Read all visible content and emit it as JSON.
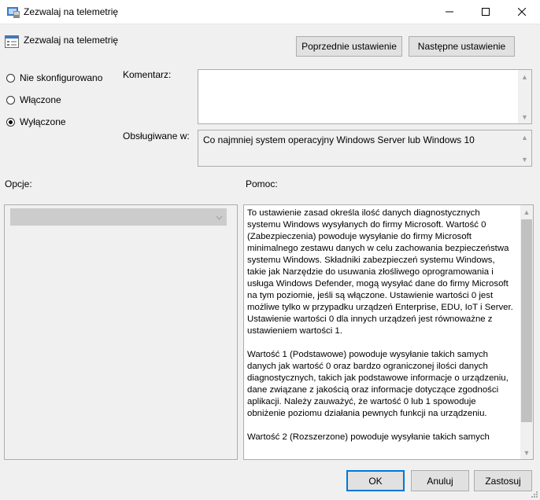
{
  "window": {
    "title": "Zezwalaj na telemetrię",
    "icons": [
      "policy-icon",
      "minimize-icon",
      "maximize-icon",
      "close-icon"
    ]
  },
  "header": {
    "title": "Zezwalaj na telemetrię",
    "prev_button": "Poprzednie ustawienie",
    "next_button": "Następne ustawienie"
  },
  "radios": [
    {
      "label": "Nie skonfigurowano",
      "checked": false
    },
    {
      "label": "Włączone",
      "checked": false
    },
    {
      "label": "Wyłączone",
      "checked": true
    }
  ],
  "comment": {
    "label": "Komentarz:",
    "value": ""
  },
  "supported": {
    "label": "Obsługiwane w:",
    "value": "Co najmniej system operacyjny Windows Server lub Windows 10"
  },
  "options": {
    "label": "Opcje:",
    "dropdown_value": ""
  },
  "help": {
    "label": "Pomoc:",
    "paragraphs": [
      "To ustawienie zasad określa ilość danych diagnostycznych systemu Windows wysyłanych do firmy Microsoft. Wartość 0 (Zabezpieczenia) powoduje wysyłanie do firmy Microsoft minimalnego zestawu danych w celu zachowania bezpieczeństwa systemu Windows. Składniki zabezpieczeń systemu Windows, takie jak Narzędzie do usuwania złośliwego oprogramowania i usługa Windows Defender, mogą wysyłać dane do firmy Microsoft na tym poziomie, jeśli są włączone. Ustawienie wartości 0 jest możliwe tylko w przypadku urządzeń Enterprise, EDU, IoT i Server. Ustawienie wartości 0 dla innych urządzeń jest równoważne z ustawieniem wartości 1.",
      "Wartość 1 (Podstawowe) powoduje wysyłanie takich samych danych jak wartość 0 oraz bardzo ograniczonej ilości danych diagnostycznych, takich jak podstawowe informacje o urządzeniu, dane związane z jakością oraz informacje dotyczące zgodności aplikacji. Należy zauważyć, że wartość 0 lub 1 spowoduje obniżenie poziomu działania pewnych funkcji na urządzeniu.",
      "Wartość 2 (Rozszerzone) powoduje wysyłanie takich samych"
    ]
  },
  "footer": {
    "ok": "OK",
    "cancel": "Anuluj",
    "apply": "Zastosuj"
  }
}
